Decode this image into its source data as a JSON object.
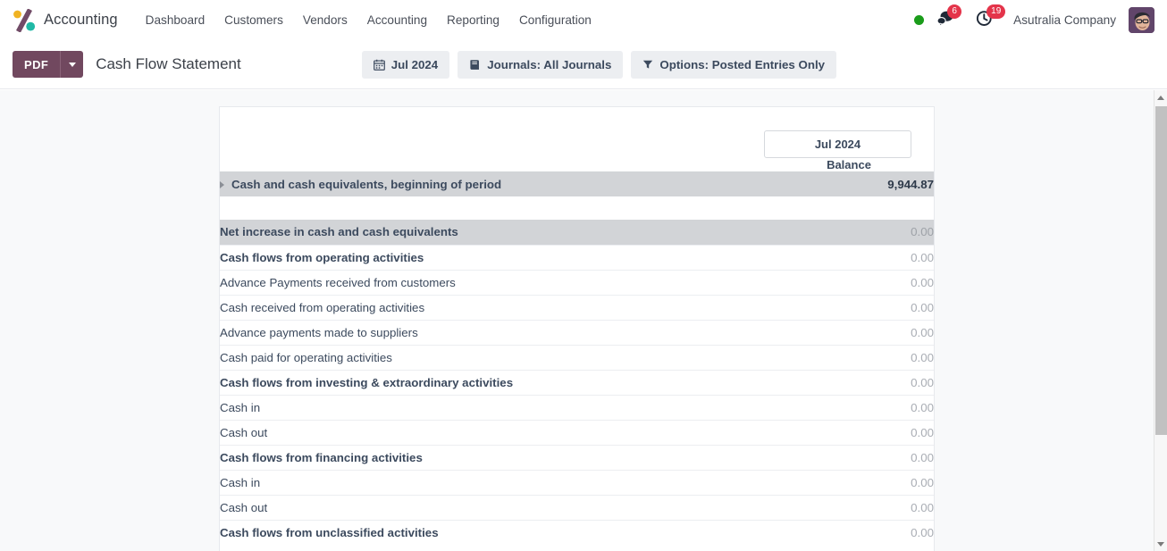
{
  "navbar": {
    "brand": "Accounting",
    "logo_icon": "odoo-logo-icon",
    "menu": [
      {
        "label": "Dashboard"
      },
      {
        "label": "Customers"
      },
      {
        "label": "Vendors"
      },
      {
        "label": "Accounting"
      },
      {
        "label": "Reporting"
      },
      {
        "label": "Configuration"
      }
    ],
    "status_indicator": "online-status-dot",
    "messages": {
      "icon": "messages-icon",
      "count": "6"
    },
    "activities": {
      "icon": "clock-icon",
      "count": "19"
    },
    "company": "Asutralia Company",
    "avatar_icon": "user-avatar"
  },
  "control_panel": {
    "pdf_label": "PDF",
    "pdf_caret_icon": "chevron-down-icon",
    "title": "Cash Flow Statement",
    "filters": [
      {
        "label": "Jul 2024",
        "icon": "calendar-icon"
      },
      {
        "label": "Journals: All Journals",
        "icon": "book-icon"
      },
      {
        "label": "Options: Posted Entries Only",
        "icon": "filter-icon"
      }
    ]
  },
  "report": {
    "period_header": "Jul 2024",
    "column_header": "Balance",
    "rows": [
      {
        "label": "Cash and cash equivalents, beginning of period",
        "value": "9,944.87",
        "style": "total",
        "indent": 0,
        "expandable": true
      },
      {
        "label": "Net increase in cash and cash equivalents",
        "value": "0.00",
        "style": "total",
        "indent": 1,
        "expandable": false
      },
      {
        "label": "Cash flows from operating activities",
        "value": "0.00",
        "style": "level1",
        "indent": 1,
        "expandable": false
      },
      {
        "label": "Advance Payments received from customers",
        "value": "0.00",
        "style": "level2",
        "indent": 3,
        "expandable": false
      },
      {
        "label": "Cash received from operating activities",
        "value": "0.00",
        "style": "level2",
        "indent": 3,
        "expandable": false
      },
      {
        "label": "Advance payments made to suppliers",
        "value": "0.00",
        "style": "level2",
        "indent": 3,
        "expandable": false
      },
      {
        "label": "Cash paid for operating activities",
        "value": "0.00",
        "style": "level2",
        "indent": 3,
        "expandable": false
      },
      {
        "label": "Cash flows from investing & extraordinary activities",
        "value": "0.00",
        "style": "level1",
        "indent": 1,
        "expandable": false
      },
      {
        "label": "Cash in",
        "value": "0.00",
        "style": "level2",
        "indent": 3,
        "expandable": false
      },
      {
        "label": "Cash out",
        "value": "0.00",
        "style": "level2",
        "indent": 3,
        "expandable": false
      },
      {
        "label": "Cash flows from financing activities",
        "value": "0.00",
        "style": "level1",
        "indent": 1,
        "expandable": false
      },
      {
        "label": "Cash in",
        "value": "0.00",
        "style": "level2",
        "indent": 3,
        "expandable": false
      },
      {
        "label": "Cash out",
        "value": "0.00",
        "style": "level2",
        "indent": 3,
        "expandable": false
      },
      {
        "label": "Cash flows from unclassified activities",
        "value": "0.00",
        "style": "level1",
        "indent": 1,
        "expandable": false
      }
    ]
  },
  "colors": {
    "brand_purple": "#71485f",
    "badge_red": "#e4344a",
    "status_green": "#1a9c1a",
    "total_row_bg": "#d2d4d7",
    "page_bg": "#f8f9fa",
    "muted_value": "#a9adb4"
  }
}
